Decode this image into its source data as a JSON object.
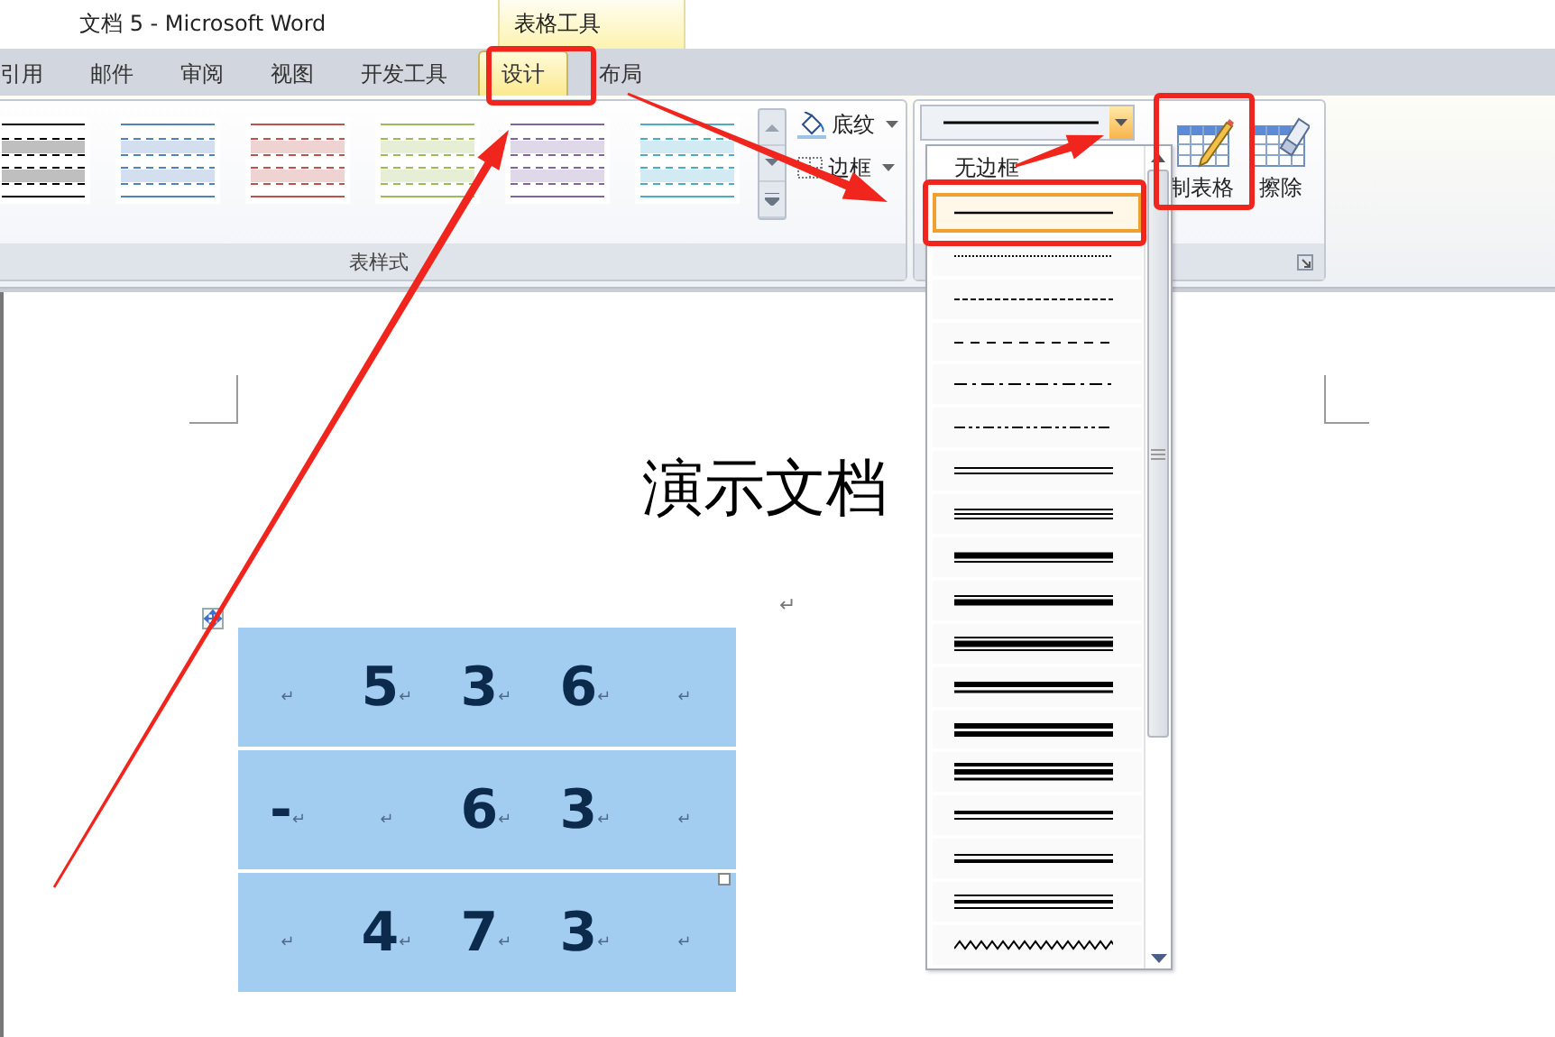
{
  "window": {
    "title": "文档 5 - Microsoft Word",
    "context_tab_header": "表格工具"
  },
  "tabs": [
    {
      "label": "引用",
      "selected": false
    },
    {
      "label": "邮件",
      "selected": false
    },
    {
      "label": "审阅",
      "selected": false
    },
    {
      "label": "视图",
      "selected": false
    },
    {
      "label": "开发工具",
      "selected": false
    },
    {
      "label": "设计",
      "selected": true
    },
    {
      "label": "布局",
      "selected": false
    }
  ],
  "table_styles_group": {
    "label": "表样式",
    "styles": [
      {
        "color": "#000000"
      },
      {
        "color": "#4f81bd"
      },
      {
        "color": "#c0504d"
      },
      {
        "color": "#9bbb59"
      },
      {
        "color": "#8064a2"
      },
      {
        "color": "#4bacc6"
      }
    ],
    "buttons": [
      {
        "label": "底纹",
        "kind": "shading"
      },
      {
        "label": "边框",
        "kind": "borders"
      }
    ]
  },
  "draw_borders_group": {
    "buttons": [
      {
        "label": "制表格",
        "kind": "draw"
      },
      {
        "label": "擦除",
        "kind": "erase"
      }
    ]
  },
  "line_style_dropdown": {
    "items": [
      {
        "kind": "none",
        "label": "无边框",
        "selected": false
      },
      {
        "kind": "solid",
        "selected": true
      },
      {
        "kind": "dotted",
        "selected": false
      },
      {
        "kind": "finedash",
        "selected": false
      },
      {
        "kind": "dash",
        "selected": false
      },
      {
        "kind": "dashdot",
        "selected": false
      },
      {
        "kind": "dashdotdot",
        "selected": false
      },
      {
        "kind": "double",
        "selected": false
      },
      {
        "kind": "triple",
        "selected": false
      },
      {
        "kind": "thickthin",
        "selected": false
      },
      {
        "kind": "thinthick",
        "selected": false
      },
      {
        "kind": "thinthickthin",
        "selected": false
      },
      {
        "kind": "thickthin2",
        "selected": false
      },
      {
        "kind": "thickthick",
        "selected": false
      },
      {
        "kind": "medthickthin",
        "selected": false
      },
      {
        "kind": "medthin",
        "selected": false
      },
      {
        "kind": "thinmed",
        "selected": false
      },
      {
        "kind": "thinmedthin",
        "selected": false
      },
      {
        "kind": "wave",
        "selected": false
      }
    ]
  },
  "document": {
    "title": "演示文档",
    "paragraph_mark": "↵",
    "table": {
      "rows": [
        [
          {
            "text": "",
            "mark": "↵"
          },
          {
            "text": "5",
            "mark": "↵"
          },
          {
            "text": "3",
            "mark": "↵"
          },
          {
            "text": "6",
            "mark": "↵"
          },
          {
            "text": "",
            "mark": "↵"
          }
        ],
        [
          {
            "text": "-",
            "mark": "↵"
          },
          {
            "text": "",
            "mark": "↵"
          },
          {
            "text": "6",
            "mark": "↵"
          },
          {
            "text": "3",
            "mark": "↵"
          },
          {
            "text": "",
            "mark": "↵"
          }
        ],
        [
          {
            "text": "",
            "mark": "↵"
          },
          {
            "text": "4",
            "mark": "↵"
          },
          {
            "text": "7",
            "mark": "↵"
          },
          {
            "text": "3",
            "mark": "↵"
          },
          {
            "text": "",
            "mark": "↵"
          }
        ]
      ]
    }
  }
}
